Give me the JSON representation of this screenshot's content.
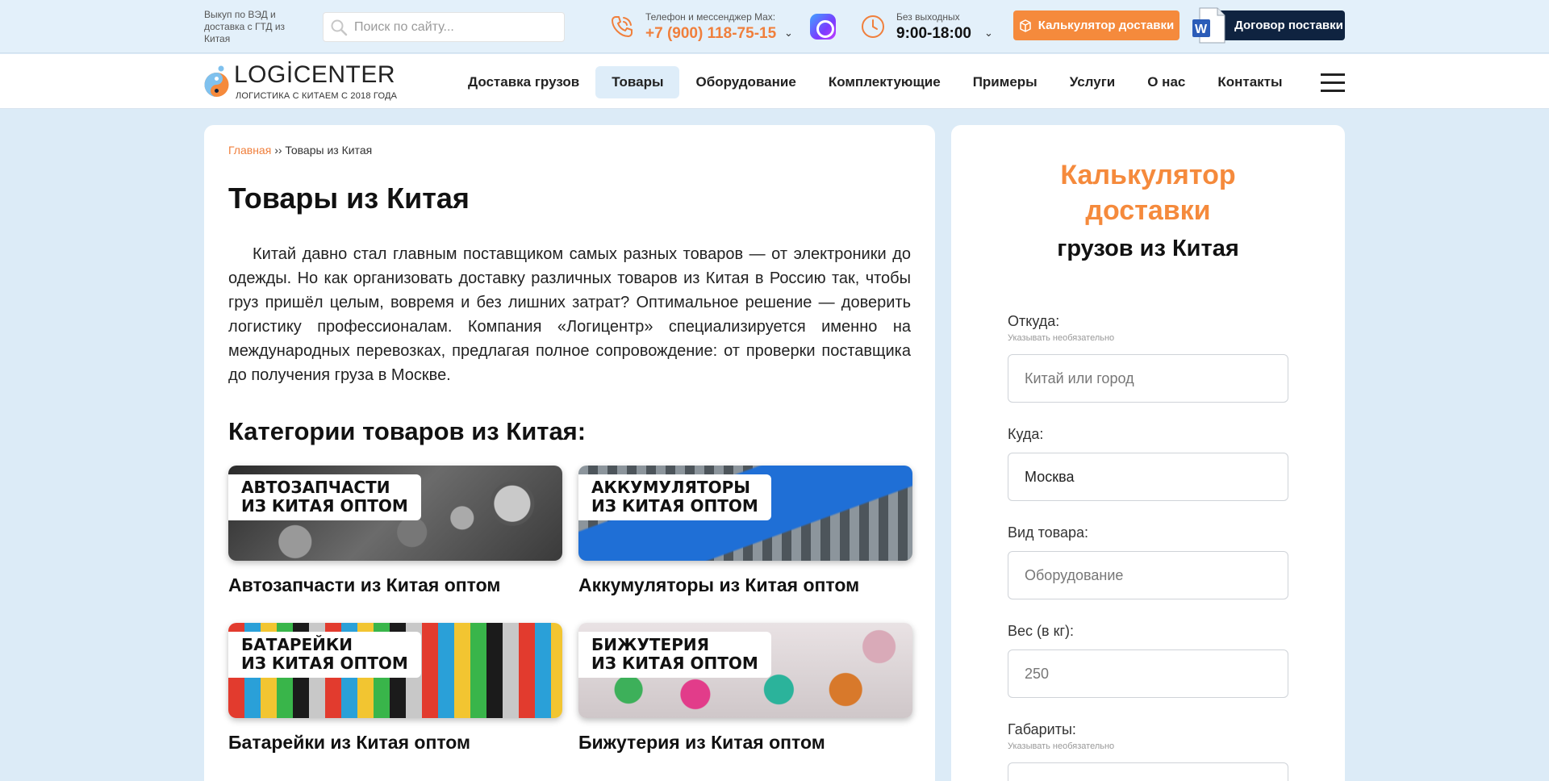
{
  "topbar": {
    "tagline": "Выкуп по ВЭД и доставка с ГТД из Китая",
    "search_placeholder": "Поиск по сайту...",
    "phone_label": "Телефон и мессенджер Max:",
    "phone_number": "+7 (900) 118-75-15",
    "hours_label": "Без выходных",
    "hours": "9:00-18:00",
    "calc_button": "Калькулятор доставки",
    "contract_button": "Договор поставки",
    "accent_color": "#f58a3c",
    "dark_color": "#0f2340"
  },
  "logo": {
    "name": "LOGİCENTER",
    "subtitle": "ЛОГИСТИКА С КИТАЕМ С 2018 ГОДА"
  },
  "nav": {
    "items": [
      {
        "label": "Доставка грузов",
        "active": false
      },
      {
        "label": "Товары",
        "active": true
      },
      {
        "label": "Оборудование",
        "active": false
      },
      {
        "label": "Комплектующие",
        "active": false
      },
      {
        "label": "Примеры",
        "active": false
      },
      {
        "label": "Услуги",
        "active": false
      },
      {
        "label": "О нас",
        "active": false
      },
      {
        "label": "Контакты",
        "active": false
      }
    ],
    "menu_icon": "hamburger-icon"
  },
  "breadcrumb": {
    "home": "Главная",
    "separator": "››",
    "current": "Товары из Китая"
  },
  "main": {
    "title": "Товары из Китая",
    "intro": "Китай давно стал главным поставщиком самых разных товаров — от электроники до одежды. Но как организовать доставку различных товаров из Китая в Россию так, чтобы груз пришёл целым, вовремя и без лишних затрат? Оптимальное решение — доверить логистику профессионалам. Компания «Логицентр» специализируется именно на международных перевозках, предлагая полное сопровождение: от проверки поставщика до получения груза в Москве.",
    "categories_title": "Категории товаров из Китая:",
    "categories": [
      {
        "badge_line1": "АВТОЗАПЧАСТИ",
        "badge_line2": "ИЗ КИТАЯ ОПТОМ",
        "caption": "Автозапчасти из Китая оптом"
      },
      {
        "badge_line1": "АККУМУЛЯТОРЫ",
        "badge_line2": "ИЗ КИТАЯ ОПТОМ",
        "caption": "Аккумуляторы из Китая оптом"
      },
      {
        "badge_line1": "БАТАРЕЙКИ",
        "badge_line2": "ИЗ КИТАЯ ОПТОМ",
        "caption": "Батарейки из Китая оптом"
      },
      {
        "badge_line1": "БИЖУТЕРИЯ",
        "badge_line2": "ИЗ КИТАЯ ОПТОМ",
        "caption": "Бижутерия из Китая оптом"
      }
    ]
  },
  "calculator": {
    "title": "Калькулятор доставки",
    "subtitle": "грузов из Китая",
    "fields": [
      {
        "label": "Откуда:",
        "hint": "Указывать необязательно",
        "value": "",
        "placeholder": "Китай или город"
      },
      {
        "label": "Куда:",
        "hint": "",
        "value": "Москва",
        "placeholder": ""
      },
      {
        "label": "Вид товара:",
        "hint": "",
        "value": "",
        "placeholder": "Оборудование"
      },
      {
        "label": "Вес (в кг):",
        "hint": "",
        "value": "",
        "placeholder": "250"
      },
      {
        "label": "Габариты:",
        "hint": "Указывать необязательно",
        "value": "",
        "placeholder": ""
      }
    ]
  }
}
